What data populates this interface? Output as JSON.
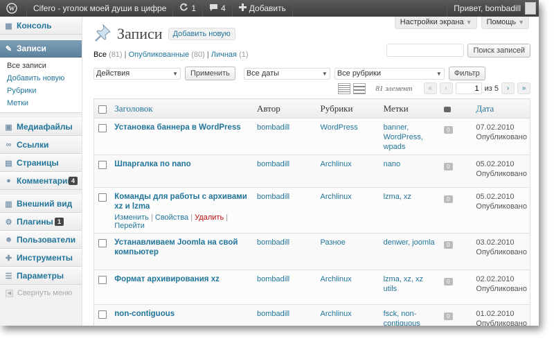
{
  "adminbar": {
    "wp_logo": "wp-logo-icon",
    "site_title": "Cifero - уголок моей души в цифре",
    "updates_count": "1",
    "comments_count": "4",
    "add_new": "Добавить",
    "greeting": "Привет, bombadill"
  },
  "sidebar": {
    "dashboard": "Консоль",
    "posts": "Записи",
    "posts_sub": [
      "Все записи",
      "Добавить новую",
      "Рубрики",
      "Метки"
    ],
    "media": "Медиафайлы",
    "links": "Ссылки",
    "pages": "Страницы",
    "comments": "Комментарии",
    "comments_badge": "4",
    "appearance": "Внешний вид",
    "plugins": "Плагины",
    "plugins_badge": "1",
    "users": "Пользователи",
    "tools": "Инструменты",
    "settings": "Параметры",
    "collapse": "Свернуть меню"
  },
  "header": {
    "screen_options": "Настройки экрана",
    "help": "Помощь",
    "title": "Записи",
    "add_new": "Добавить новую"
  },
  "views": {
    "all": "Все",
    "all_count": "(81)",
    "published": "Опубликованные",
    "published_count": "(80)",
    "private": "Личная",
    "private_count": "(1)",
    "sep": "|"
  },
  "search": {
    "value": "",
    "button": "Поиск записей"
  },
  "filters": {
    "bulk_actions": "Действия",
    "apply": "Применить",
    "dates": "Все даты",
    "categories": "Все рубрики",
    "filter": "Фильтр"
  },
  "pagination": {
    "items": "81 элемент",
    "first": "«",
    "prev": "‹",
    "current": "1",
    "of_total": "из 5",
    "next": "›",
    "last": "»"
  },
  "table": {
    "columns": {
      "title": "Заголовок",
      "author": "Автор",
      "categories": "Рубрики",
      "tags": "Метки",
      "date": "Дата"
    },
    "rows": [
      {
        "title": "Установка баннера в WordPress",
        "author": "bombadill",
        "category": "WordPress",
        "tags": "banner, WordPress, wpads",
        "comments": "0",
        "date": "07.02.2010",
        "status": "Опубликовано"
      },
      {
        "title": "Шпаргалка по nano",
        "author": "bombadill",
        "category": "Archlinux",
        "tags": "nano",
        "comments": "0",
        "date": "05.02.2010",
        "status": "Опубликовано"
      },
      {
        "title": "Команды для работы с архивами xz и lzma",
        "author": "bombadill",
        "category": "Archlinux",
        "tags": "lzma, xz",
        "comments": "0",
        "date": "05.02.2010",
        "status": "Опубликовано"
      },
      {
        "title": "Устанавливаем Joomla на свой компьютер",
        "author": "bombadill",
        "category": "Разное",
        "tags": "denwer, joomla",
        "comments": "0",
        "date": "03.02.2010",
        "status": "Опубликовано"
      },
      {
        "title": "Формат архивирования xz",
        "author": "bombadill",
        "category": "Archlinux",
        "tags": "lzma, xz, xz utils",
        "comments": "0",
        "date": "02.02.2010",
        "status": "Опубликовано"
      },
      {
        "title": "non-contiguous",
        "author": "bombadill",
        "category": "Archlinux",
        "tags": "fsck, non-contiguous",
        "comments": "0",
        "date": "01.02.2010",
        "status": "Опубликовано"
      }
    ],
    "row_actions": {
      "edit": "Изменить",
      "quick_edit": "Свойства",
      "trash": "Удалить",
      "view": "Перейти",
      "sep": "|"
    }
  },
  "colors": {
    "link": "#21759b",
    "adminbar": "#464646",
    "active_menu": "#6d8ba5",
    "delete": "#bc0b0b"
  }
}
